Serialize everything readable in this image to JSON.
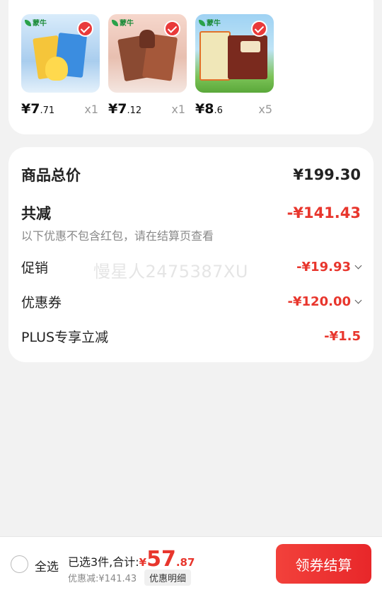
{
  "products": [
    {
      "brand": "蒙牛",
      "price_main": "¥7",
      "price_decimal": ".71",
      "qty": "x1"
    },
    {
      "brand": "蒙牛",
      "price_main": "¥7",
      "price_decimal": ".12",
      "qty": "x1"
    },
    {
      "brand": "蒙牛",
      "price_main": "¥8",
      "price_decimal": ".6",
      "qty": "x5"
    }
  ],
  "summary": {
    "total_label": "商品总价",
    "total_value": "¥199.30",
    "reduce_label": "共减",
    "reduce_value": "-¥141.43",
    "note": "以下优惠不包含红包，请在结算页查看",
    "promo_label": "促销",
    "promo_value": "-¥19.93",
    "coupon_label": "优惠券",
    "coupon_value": "-¥120.00",
    "plus_label": "PLUS专享立减",
    "plus_value": "-¥1.5"
  },
  "watermark": "慢星人2475387XU",
  "bottom": {
    "select_all": "全选",
    "selected_text": "已选3件,合计:",
    "total_yen": "¥",
    "total_integer": "57",
    "total_decimal": ".87",
    "discount_text": "优惠减:¥141.43",
    "detail_label": "优惠明细",
    "checkout_label": "领券结算"
  },
  "colors": {
    "accent": "#e8362d",
    "background": "#f2f2f2"
  }
}
